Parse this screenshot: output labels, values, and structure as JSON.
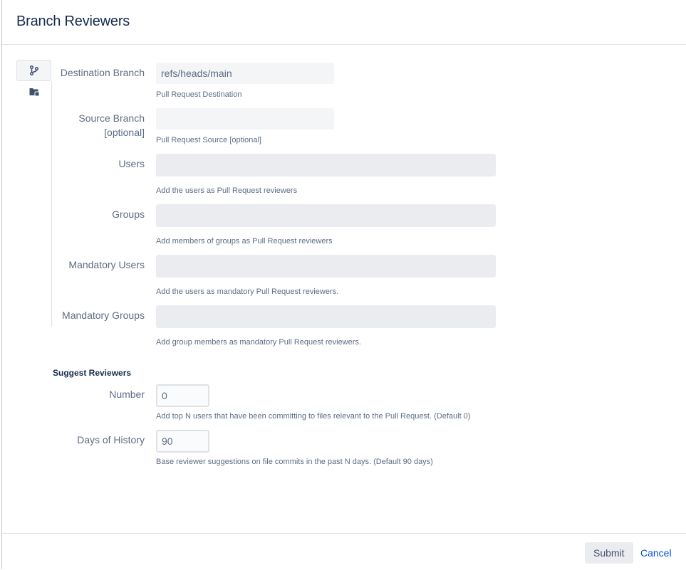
{
  "dialog": {
    "title": "Branch Reviewers"
  },
  "sidebar": {
    "items": [
      {
        "icon": "git-branch-icon",
        "active": true
      },
      {
        "icon": "folder-icon",
        "active": false
      }
    ]
  },
  "fields": {
    "destination_branch": {
      "label": "Destination Branch",
      "value": "refs/heads/main",
      "help": "Pull Request Destination"
    },
    "source_branch": {
      "label_line1": "Source Branch",
      "label_line2": "[optional]",
      "value": "",
      "help": "Pull Request Source [optional]"
    },
    "users": {
      "label": "Users",
      "value": "",
      "help": "Add the users as Pull Request reviewers"
    },
    "groups": {
      "label": "Groups",
      "value": "",
      "help": "Add members of groups as Pull Request reviewers"
    },
    "mandatory_users": {
      "label": "Mandatory Users",
      "value": "",
      "help": "Add the users as mandatory Pull Request reviewers."
    },
    "mandatory_groups": {
      "label": "Mandatory Groups",
      "value": "",
      "help": "Add group members as mandatory Pull Request reviewers."
    }
  },
  "suggest": {
    "heading": "Suggest Reviewers",
    "number": {
      "label": "Number",
      "value": "0",
      "help": "Add top N users that have been committing to files relevant to the Pull Request. (Default 0)"
    },
    "days": {
      "label": "Days of History",
      "value": "90",
      "help": "Base reviewer suggestions on file commits in the past N days. (Default 90 days)"
    }
  },
  "footer": {
    "submit_label": "Submit",
    "cancel_label": "Cancel"
  }
}
